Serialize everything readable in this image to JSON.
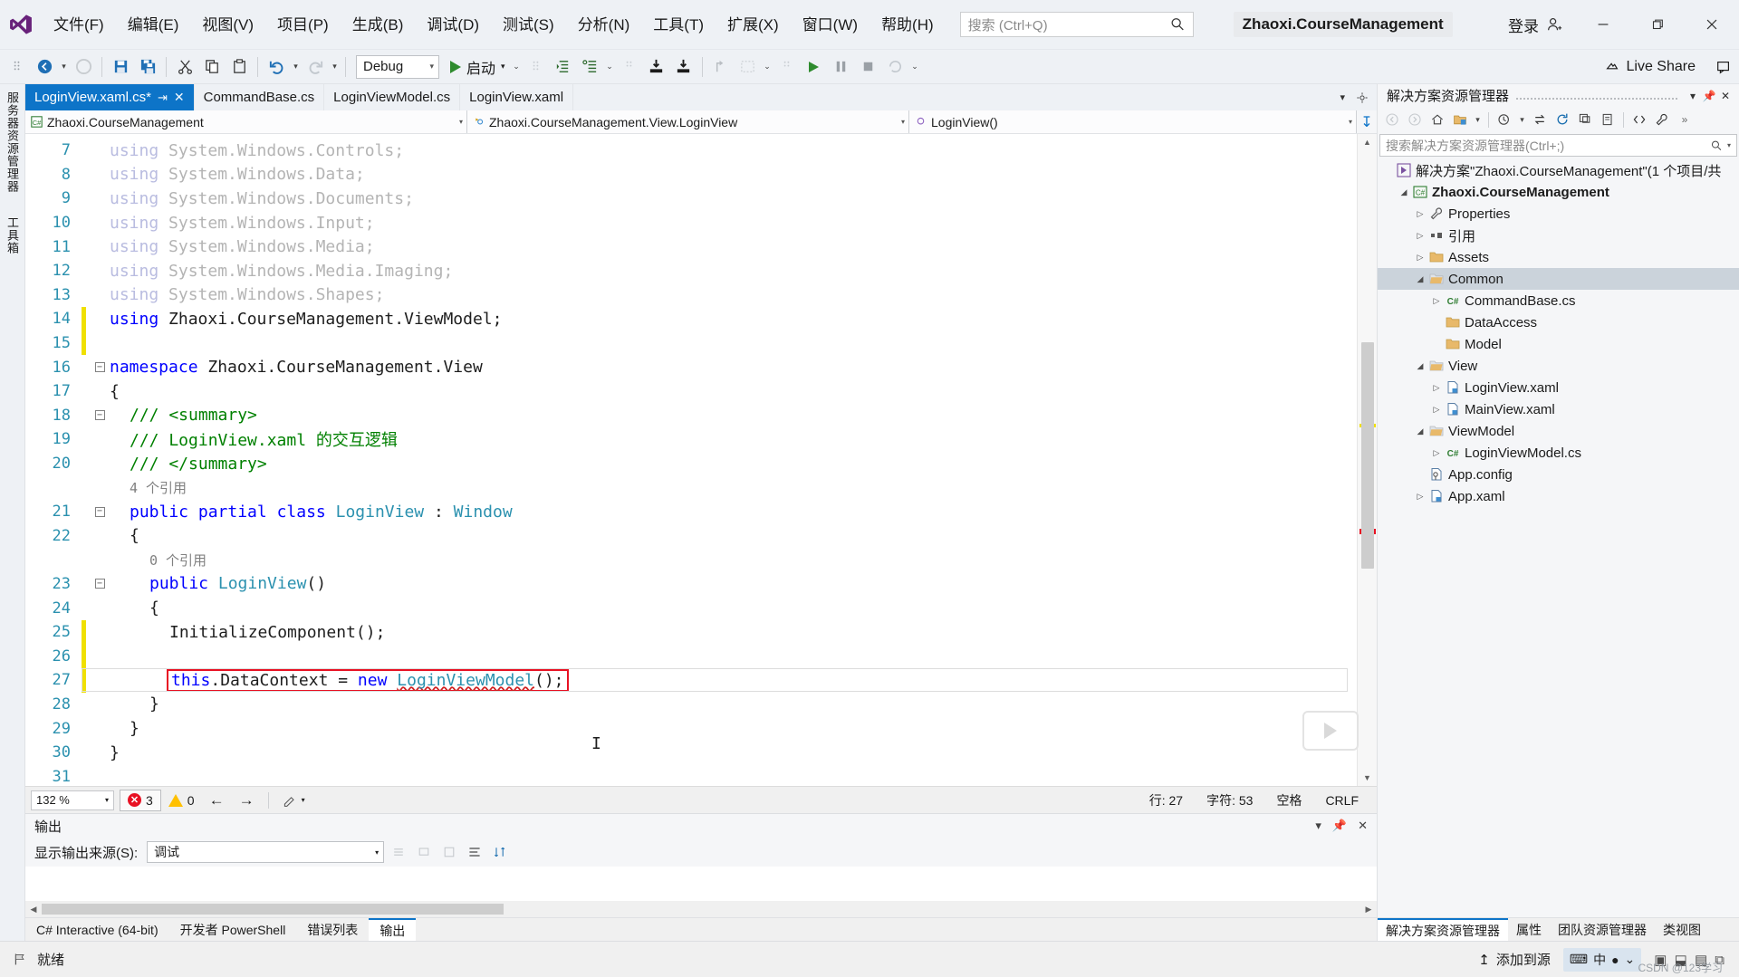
{
  "titlebar": {
    "menus": [
      "文件(F)",
      "编辑(E)",
      "视图(V)",
      "项目(P)",
      "生成(B)",
      "调试(D)",
      "测试(S)",
      "分析(N)",
      "工具(T)",
      "扩展(X)",
      "窗口(W)",
      "帮助(H)"
    ],
    "search_placeholder": "搜索 (Ctrl+Q)",
    "project_title": "Zhaoxi.CourseManagement",
    "signin_label": "登录",
    "minimize_label": "最小化",
    "maximize_label": "最大化",
    "close_label": "关闭"
  },
  "toolbar": {
    "config_value": "Debug",
    "start_label": "启动",
    "live_share_label": "Live Share"
  },
  "vstrips": {
    "left_top": "服务器资源管理器",
    "left_bottom": "工具箱"
  },
  "tabs": [
    {
      "label": "LoginView.xaml.cs*",
      "active": true,
      "pin": "⇥",
      "close": "✕"
    },
    {
      "label": "CommandBase.cs",
      "active": false
    },
    {
      "label": "LoginViewModel.cs",
      "active": false
    },
    {
      "label": "LoginView.xaml",
      "active": false
    }
  ],
  "navbar": {
    "project": "Zhaoxi.CourseManagement",
    "type": "Zhaoxi.CourseManagement.View.LoginView",
    "member": "LoginView()"
  },
  "code": {
    "lines": [
      {
        "num": "7",
        "change": "none",
        "glyph": "",
        "indent": 0,
        "dim": true,
        "text": "using System.Windows.Controls;"
      },
      {
        "num": "8",
        "change": "none",
        "glyph": "",
        "indent": 0,
        "dim": true,
        "text": "using System.Windows.Data;"
      },
      {
        "num": "9",
        "change": "none",
        "glyph": "",
        "indent": 0,
        "dim": true,
        "text": "using System.Windows.Documents;"
      },
      {
        "num": "10",
        "change": "none",
        "glyph": "",
        "indent": 0,
        "dim": true,
        "text": "using System.Windows.Input;"
      },
      {
        "num": "11",
        "change": "none",
        "glyph": "",
        "indent": 0,
        "dim": true,
        "text": "using System.Windows.Media;"
      },
      {
        "num": "12",
        "change": "none",
        "glyph": "",
        "indent": 0,
        "dim": true,
        "text": "using System.Windows.Media.Imaging;"
      },
      {
        "num": "13",
        "change": "none",
        "glyph": "",
        "indent": 0,
        "dim": true,
        "text": "using System.Windows.Shapes;"
      },
      {
        "num": "14",
        "change": "yellow",
        "glyph": "",
        "indent": 0,
        "dim": false,
        "text": "using Zhaoxi.CourseManagement.ViewModel;"
      },
      {
        "num": "15",
        "change": "yellow",
        "glyph": "",
        "indent": 0,
        "dim": false,
        "text": ""
      },
      {
        "num": "16",
        "change": "none",
        "glyph": "minus",
        "indent": 0,
        "dim": false,
        "text": "namespace Zhaoxi.CourseManagement.View"
      },
      {
        "num": "17",
        "change": "none",
        "glyph": "",
        "indent": 0,
        "dim": false,
        "text": "{"
      },
      {
        "num": "18",
        "change": "none",
        "glyph": "minus",
        "indent": 1,
        "dim": false,
        "text": "/// <summary>"
      },
      {
        "num": "19",
        "change": "none",
        "glyph": "",
        "indent": 1,
        "dim": false,
        "text": "/// LoginView.xaml 的交互逻辑"
      },
      {
        "num": "20",
        "change": "none",
        "glyph": "",
        "indent": 1,
        "dim": false,
        "text": "/// </summary>"
      },
      {
        "num": "",
        "change": "none",
        "glyph": "",
        "indent": 1,
        "dim": false,
        "text": "4 个引用",
        "isref": true
      },
      {
        "num": "21",
        "change": "none",
        "glyph": "minus",
        "indent": 1,
        "dim": false,
        "text": "public partial class LoginView : Window"
      },
      {
        "num": "22",
        "change": "none",
        "glyph": "",
        "indent": 1,
        "dim": false,
        "text": "{"
      },
      {
        "num": "",
        "change": "none",
        "glyph": "",
        "indent": 2,
        "dim": false,
        "text": "0 个引用",
        "isref": true
      },
      {
        "num": "23",
        "change": "none",
        "glyph": "minus",
        "indent": 2,
        "dim": false,
        "text": "public LoginView()"
      },
      {
        "num": "24",
        "change": "none",
        "glyph": "",
        "indent": 2,
        "dim": false,
        "text": "{"
      },
      {
        "num": "25",
        "change": "yellow",
        "glyph": "",
        "indent": 3,
        "dim": false,
        "text": "InitializeComponent();"
      },
      {
        "num": "26",
        "change": "yellow",
        "glyph": "",
        "indent": 3,
        "dim": false,
        "text": ""
      },
      {
        "num": "27",
        "change": "yellow",
        "glyph": "",
        "indent": 3,
        "dim": false,
        "text": "this.DataContext = new LoginViewModel();",
        "error": true,
        "current": true
      },
      {
        "num": "28",
        "change": "none",
        "glyph": "",
        "indent": 2,
        "dim": false,
        "text": "}"
      },
      {
        "num": "29",
        "change": "none",
        "glyph": "",
        "indent": 1,
        "dim": false,
        "text": "}"
      },
      {
        "num": "30",
        "change": "none",
        "glyph": "",
        "indent": 0,
        "dim": false,
        "text": "}"
      },
      {
        "num": "31",
        "change": "none",
        "glyph": "",
        "indent": 0,
        "dim": false,
        "text": ""
      }
    ]
  },
  "editor_status": {
    "zoom": "132 %",
    "error_count": "3",
    "warning_count": "0",
    "line_label": "行: 27",
    "col_label": "字符: 53",
    "space_label": "空格",
    "eol_label": "CRLF"
  },
  "output": {
    "title": "输出",
    "source_label": "显示输出来源(S):",
    "source_value": "调试"
  },
  "bottom_tabs": [
    {
      "label": "C# Interactive (64-bit)",
      "active": false
    },
    {
      "label": "开发者 PowerShell",
      "active": false
    },
    {
      "label": "错误列表",
      "active": false
    },
    {
      "label": "输出",
      "active": true
    }
  ],
  "solution_explorer": {
    "title": "解决方案资源管理器",
    "search_placeholder": "搜索解决方案资源管理器(Ctrl+;)",
    "tree": [
      {
        "depth": 0,
        "arrow": "",
        "icon": "solution",
        "label": "解决方案\"Zhaoxi.CourseManagement\"(1 个项目/共",
        "bold": false,
        "selected": false
      },
      {
        "depth": 1,
        "arrow": "open",
        "icon": "csproj",
        "label": "Zhaoxi.CourseManagement",
        "bold": true,
        "selected": false
      },
      {
        "depth": 2,
        "arrow": "close",
        "icon": "wrench",
        "label": "Properties",
        "bold": false,
        "selected": false
      },
      {
        "depth": 2,
        "arrow": "close",
        "icon": "reference",
        "label": "引用",
        "bold": false,
        "selected": false
      },
      {
        "depth": 2,
        "arrow": "close",
        "icon": "folder",
        "label": "Assets",
        "bold": false,
        "selected": false
      },
      {
        "depth": 2,
        "arrow": "open",
        "icon": "folderopen",
        "label": "Common",
        "bold": false,
        "selected": true
      },
      {
        "depth": 3,
        "arrow": "close",
        "icon": "cs",
        "label": "CommandBase.cs",
        "bold": false,
        "selected": false
      },
      {
        "depth": 3,
        "arrow": "",
        "icon": "folder",
        "label": "DataAccess",
        "bold": false,
        "selected": false
      },
      {
        "depth": 3,
        "arrow": "",
        "icon": "folder",
        "label": "Model",
        "bold": false,
        "selected": false
      },
      {
        "depth": 2,
        "arrow": "open",
        "icon": "folderopen",
        "label": "View",
        "bold": false,
        "selected": false
      },
      {
        "depth": 3,
        "arrow": "close",
        "icon": "xaml",
        "label": "LoginView.xaml",
        "bold": false,
        "selected": false
      },
      {
        "depth": 3,
        "arrow": "close",
        "icon": "xaml",
        "label": "MainView.xaml",
        "bold": false,
        "selected": false
      },
      {
        "depth": 2,
        "arrow": "open",
        "icon": "folderopen",
        "label": "ViewModel",
        "bold": false,
        "selected": false
      },
      {
        "depth": 3,
        "arrow": "close",
        "icon": "cs",
        "label": "LoginViewModel.cs",
        "bold": false,
        "selected": false
      },
      {
        "depth": 2,
        "arrow": "",
        "icon": "config",
        "label": "App.config",
        "bold": false,
        "selected": false
      },
      {
        "depth": 2,
        "arrow": "close",
        "icon": "xaml",
        "label": "App.xaml",
        "bold": false,
        "selected": false
      }
    ],
    "bottom_tabs": [
      {
        "label": "解决方案资源管理器",
        "active": true
      },
      {
        "label": "属性",
        "active": false
      },
      {
        "label": "团队资源管理器",
        "active": false
      },
      {
        "label": "类视图",
        "active": false
      }
    ]
  },
  "taskbar": {
    "status": "就绪",
    "add_source": "添加到源",
    "ime_lang": "中",
    "watermark": "CSDN @123学习"
  }
}
